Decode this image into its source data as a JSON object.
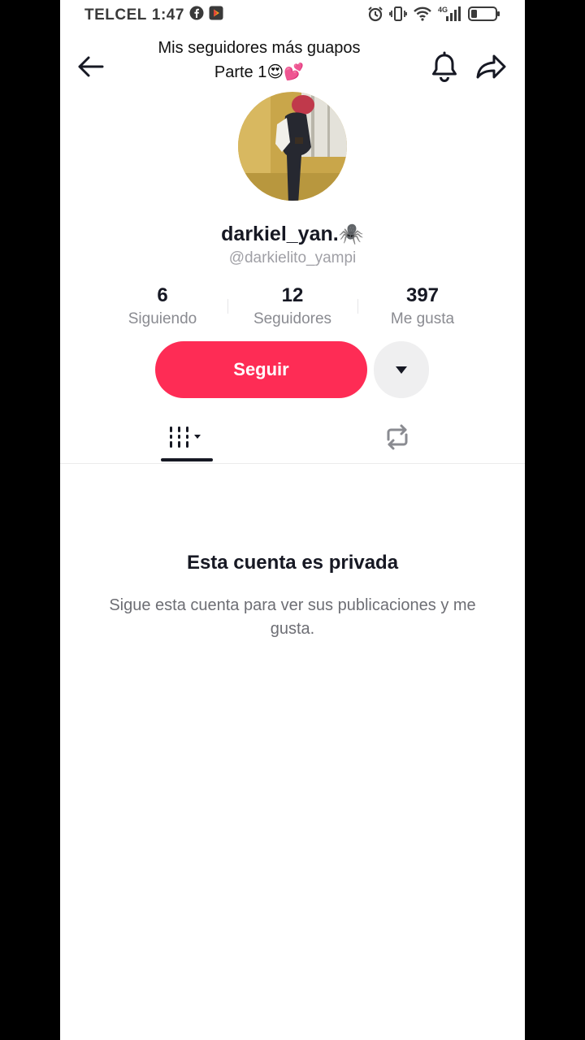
{
  "status": {
    "carrier": "TELCEL",
    "time": "1:47",
    "network": "4G"
  },
  "overlay": {
    "title_line1": "Mis seguidores más guapos",
    "title_line2": "Parte 1😍💕"
  },
  "profile": {
    "display_name": "darkiel_yan.🕷️",
    "handle": "@darkielito_yampi"
  },
  "stats": [
    {
      "value": "6",
      "label": "Siguiendo"
    },
    {
      "value": "12",
      "label": "Seguidores"
    },
    {
      "value": "397",
      "label": "Me gusta"
    }
  ],
  "actions": {
    "follow_label": "Seguir"
  },
  "private": {
    "title": "Esta cuenta es privada",
    "description": "Sigue esta cuenta para ver sus publicaciones y me gusta."
  },
  "colors": {
    "accent": "#fe2c55",
    "text_primary": "#161823",
    "text_secondary": "#8a8b91"
  },
  "icons": {
    "back": "arrow-left-icon",
    "notifications": "bell-icon",
    "share": "share-arrow-icon",
    "more": "caret-down-icon",
    "videos_tab": "grid-lines-icon",
    "reposts_tab": "repost-icon"
  }
}
